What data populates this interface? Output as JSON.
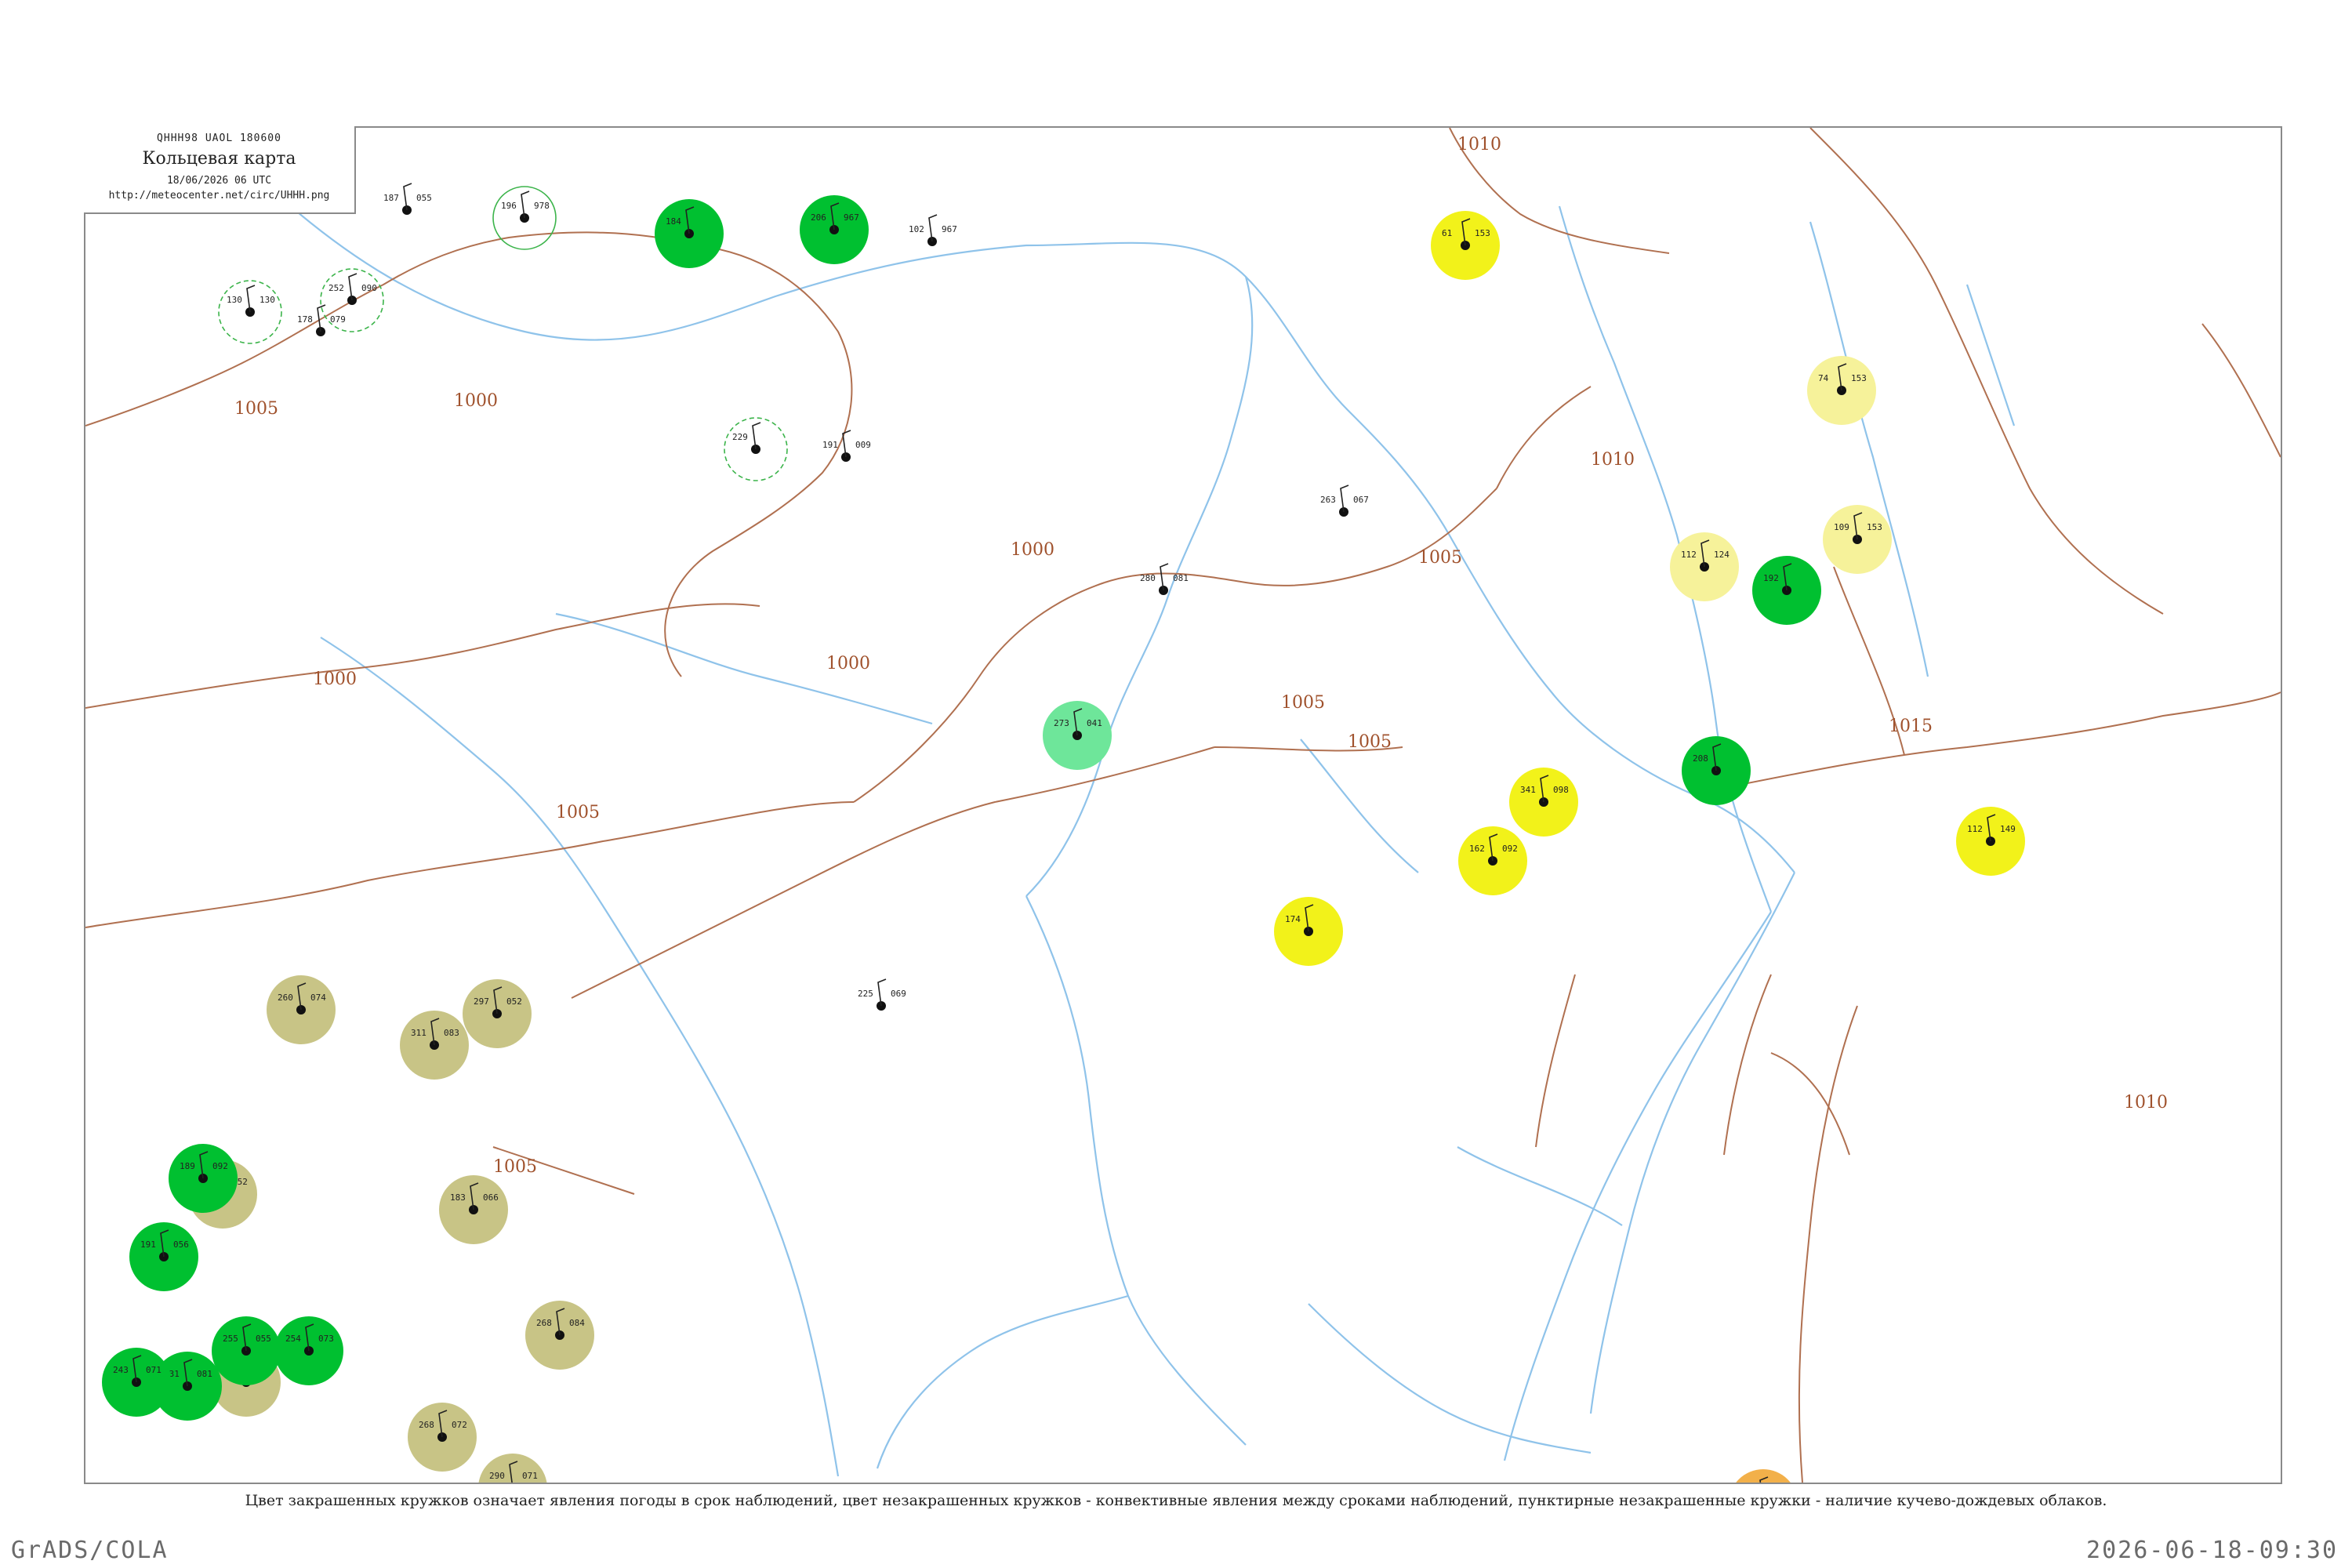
{
  "header": {
    "code": "QHHH98  UAOL  180600",
    "title": "Кольцевая карта",
    "datetime": "18/06/2026 06 UTC",
    "url": "http://meteocenter.net/circ/UHHH.png"
  },
  "caption": "Цвет закрашенных кружков означает явления погоды в срок наблюдений, цвет незакрашенных кружков - конвективные явления между сроками наблюдений, пунктирные незакрашенные кружки - наличие кучево-дождевых облаков.",
  "footer": {
    "left": "GrADS/COLA",
    "right": "2026-06-18-09:30"
  },
  "colors": {
    "isobar": "#a0522d",
    "river": "#8fc3ea",
    "rain_fill": "#00c030",
    "fog_fill": "#c8c486",
    "sun_fill": "#f2f21a",
    "light_yellow_fill": "#f6f29a",
    "orange_fill": "#f2b04a",
    "mint_fill": "#6ee69a",
    "ring_dashed": "#3cb44b"
  },
  "isobar_labels": [
    "1010",
    "1005",
    "1000",
    "1000",
    "1000",
    "1000",
    "1005",
    "1005",
    "1005",
    "1005",
    "1010",
    "1015",
    "1005",
    "1010"
  ],
  "stations": [
    {
      "t": "187",
      "p": "055",
      "id": "",
      "fill": "none"
    },
    {
      "t": "196",
      "p": "978",
      "id": "",
      "fill": "none",
      "ring": "solid"
    },
    {
      "t": "184",
      "p": "",
      "id": "",
      "fill": "rain"
    },
    {
      "t": "206",
      "p": "967",
      "id": "",
      "fill": "rain"
    },
    {
      "t": "102",
      "p": "967",
      "id": "",
      "fill": "none"
    },
    {
      "t": "130",
      "p": "130",
      "id": "",
      "fill": "none",
      "ring": "dashed"
    },
    {
      "t": "252",
      "p": "090",
      "id": "",
      "fill": "none",
      "ring": "dashed"
    },
    {
      "t": "178",
      "p": "079",
      "id": "",
      "fill": "none"
    },
    {
      "t": "229",
      "p": "",
      "id": "",
      "fill": "none",
      "ring": "dashed"
    },
    {
      "t": "191",
      "p": "009",
      "id": "",
      "fill": "none"
    },
    {
      "t": "61",
      "p": "153",
      "id": "",
      "fill": "sun"
    },
    {
      "t": "74",
      "p": "153",
      "id": "",
      "fill": "lightyellow"
    },
    {
      "t": "109",
      "p": "153",
      "id": "",
      "fill": "lightyellow"
    },
    {
      "t": "112",
      "p": "124",
      "id": "",
      "fill": "lightyellow"
    },
    {
      "t": "341",
      "p": "098",
      "id": "",
      "fill": "sun"
    },
    {
      "t": "162",
      "p": "092",
      "id": "",
      "fill": "sun"
    },
    {
      "t": "112",
      "p": "149",
      "id": "",
      "fill": "sun"
    },
    {
      "t": "174",
      "p": "",
      "id": "",
      "fill": "sun"
    },
    {
      "t": "273",
      "p": "041",
      "id": "",
      "fill": "mint"
    },
    {
      "t": "225",
      "p": "069",
      "id": "",
      "fill": "orange"
    },
    {
      "t": "260",
      "p": "074",
      "id": "",
      "fill": "fog"
    },
    {
      "t": "297",
      "p": "052",
      "id": "",
      "fill": "fog"
    },
    {
      "t": "311",
      "p": "083",
      "id": "",
      "fill": "fog"
    },
    {
      "t": "183",
      "p": "066",
      "id": "",
      "fill": "fog"
    },
    {
      "t": "268",
      "p": "084",
      "id": "",
      "fill": "fog"
    },
    {
      "t": "298",
      "p": "058",
      "id": "",
      "fill": "fog"
    },
    {
      "t": "268",
      "p": "072",
      "id": "",
      "fill": "fog"
    },
    {
      "t": "290",
      "p": "071",
      "id": "",
      "fill": "fog"
    },
    {
      "t": "260",
      "p": "052",
      "id": "",
      "fill": "fog"
    },
    {
      "t": "254",
      "p": "073",
      "id": "",
      "fill": "rain"
    },
    {
      "t": "189",
      "p": "092",
      "id": "",
      "fill": "rain"
    },
    {
      "t": "191",
      "p": "056",
      "id": "",
      "fill": "rain"
    },
    {
      "t": "255",
      "p": "055",
      "id": "",
      "fill": "rain"
    },
    {
      "t": "231",
      "p": "081",
      "id": "",
      "fill": "rain"
    },
    {
      "t": "243",
      "p": "071",
      "id": "",
      "fill": "rain"
    },
    {
      "t": "208",
      "p": "",
      "id": "",
      "fill": "rain"
    },
    {
      "t": "192",
      "p": "",
      "id": "",
      "fill": "rain"
    },
    {
      "t": "263",
      "p": "067",
      "id": "",
      "fill": "none"
    },
    {
      "t": "280",
      "p": "081",
      "id": "",
      "fill": "none"
    },
    {
      "t": "225",
      "p": "069",
      "id": "",
      "fill": "none"
    }
  ]
}
